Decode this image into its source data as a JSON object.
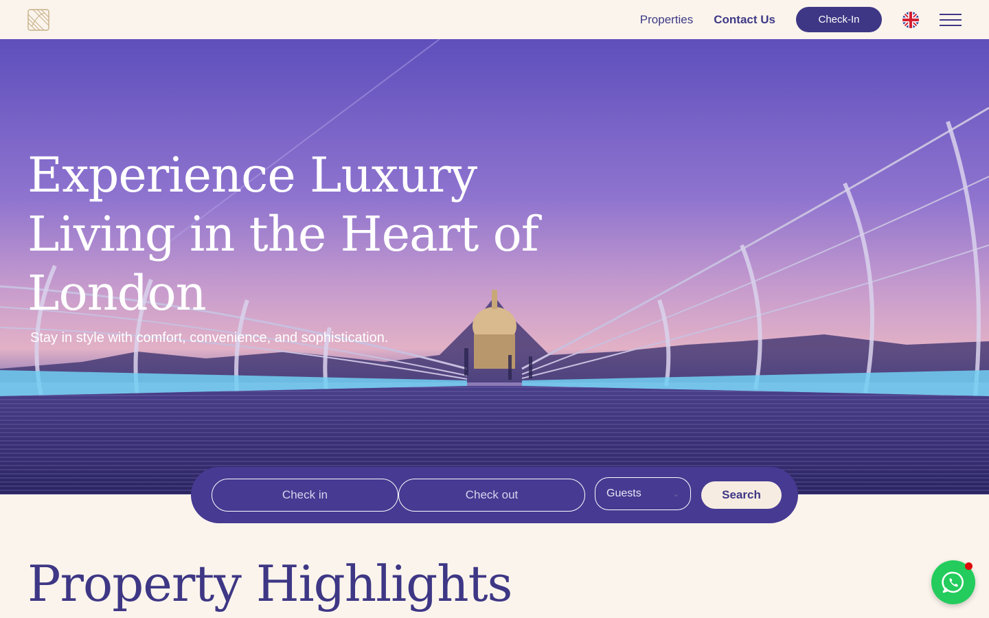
{
  "header": {
    "logo": "brand-logo-icon",
    "nav": {
      "properties": "Properties",
      "contact": "Contact Us"
    },
    "checkin_label": "Check-In",
    "language_icon": "uk-flag-icon",
    "menu_icon": "hamburger-icon"
  },
  "hero": {
    "title": "Experience Luxury Living in the Heart of London",
    "subtitle": "Stay in style with comfort, convenience, and sophistication."
  },
  "search": {
    "checkin_placeholder": "Check in",
    "checkout_placeholder": "Check out",
    "guests_label": "Guests",
    "button_label": "Search"
  },
  "highlights": {
    "title": "Property Highlights"
  },
  "whatsapp": {
    "icon": "whatsapp-icon",
    "has_notification": true
  },
  "colors": {
    "background": "#faf4ec",
    "primary": "#3e3785",
    "search_bar": "#463a92",
    "search_button": "#f6ece2",
    "whatsapp": "#23cc5c",
    "notification": "#e00b0b"
  }
}
